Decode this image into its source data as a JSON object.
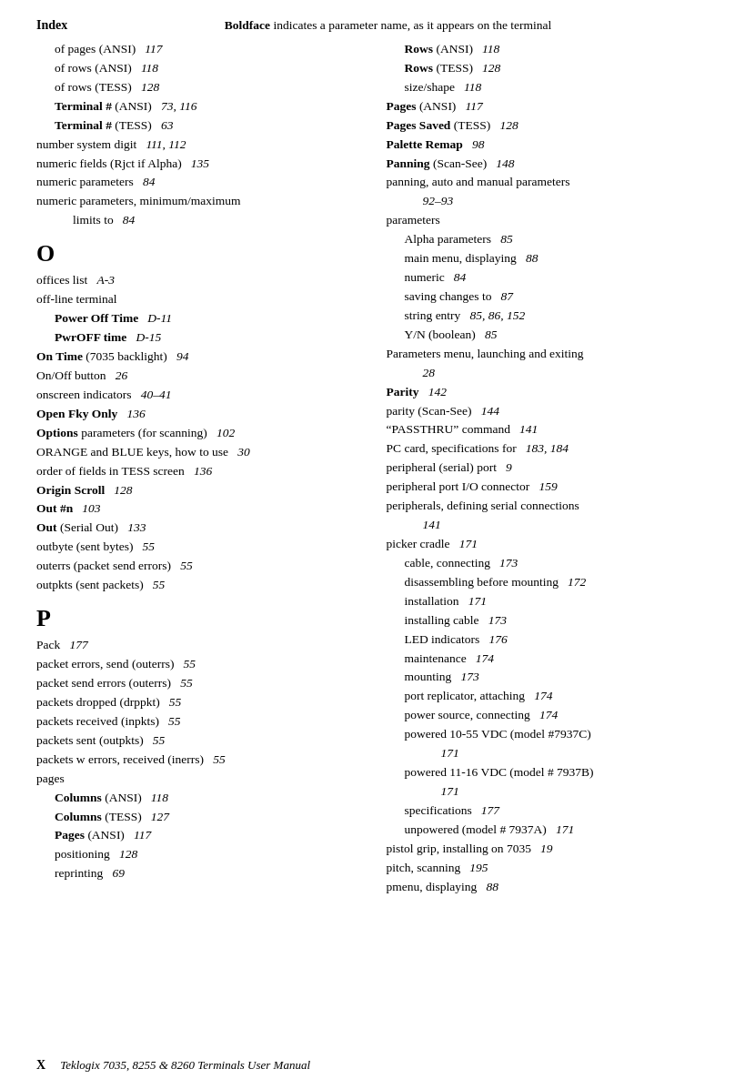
{
  "header": {
    "left_label": "Index",
    "center_bold": "Boldface",
    "center_rest": " indicates a parameter name, as it appears on the terminal"
  },
  "footer": {
    "x_label": "X",
    "title": "Teklogix 7035, 8255 & 8260 Terminals User Manual"
  },
  "left_column": {
    "entries": [
      {
        "text": "of pages (ANSI)",
        "num": "117",
        "indent": 1
      },
      {
        "text": "of rows (ANSI)",
        "num": "118",
        "indent": 1
      },
      {
        "text": "of rows (TESS)",
        "num": "128",
        "indent": 1
      },
      {
        "bold": "Terminal #",
        "after": " (ANSI)",
        "num": "73, 116",
        "indent": 1
      },
      {
        "bold": "Terminal #",
        "after": " (TESS)",
        "num": "63",
        "indent": 1
      },
      {
        "text": "number system digit",
        "num": "111, 112",
        "indent": 0
      },
      {
        "text": "numeric fields (Rjct if Alpha)",
        "num": "135",
        "indent": 0
      },
      {
        "text": "numeric parameters",
        "num": "84",
        "indent": 0
      },
      {
        "text": "numeric parameters, minimum/maximum",
        "indent": 0
      },
      {
        "text": "limits to",
        "num": "84",
        "indent": 2
      }
    ],
    "section_O": {
      "letter": "O",
      "entries": [
        {
          "text": "offices list",
          "num": "A-3",
          "italic_num": true,
          "indent": 0
        },
        {
          "text": "off-line terminal",
          "indent": 0
        },
        {
          "bold": "Power Off Time",
          "num": "D-11",
          "italic_num": true,
          "indent": 1
        },
        {
          "bold": "PwrOFF time",
          "num": "D-15",
          "italic_num": true,
          "indent": 1
        },
        {
          "bold": "On Time",
          "after": " (7035 backlight)",
          "num": "94",
          "indent": 0
        },
        {
          "text": "On/Off button",
          "num": "26",
          "indent": 0
        },
        {
          "text": "onscreen indicators",
          "num": "40–41",
          "indent": 0
        },
        {
          "bold": "Open Fky Only",
          "num": "136",
          "indent": 0
        },
        {
          "bold": "Options",
          "after": " parameters (for scanning)",
          "num": "102",
          "indent": 0
        },
        {
          "text": "ORANGE and BLUE keys, how to use",
          "num": "30",
          "indent": 0
        },
        {
          "text": "order of fields in TESS screen",
          "num": "136",
          "indent": 0
        },
        {
          "bold": "Origin Scroll",
          "num": "128",
          "indent": 0
        },
        {
          "bold": "Out #n",
          "num": "103",
          "indent": 0
        },
        {
          "bold": "Out",
          "after": " (Serial Out)",
          "num": "133",
          "indent": 0
        },
        {
          "text": "outbyte (sent bytes)",
          "num": "55",
          "indent": 0
        },
        {
          "text": "outerrs (packet send errors)",
          "num": "55",
          "indent": 0
        },
        {
          "text": "outpkts (sent packets)",
          "num": "55",
          "indent": 0
        }
      ]
    },
    "section_P": {
      "letter": "P",
      "entries": [
        {
          "text": "Pack",
          "num": "177",
          "indent": 0
        },
        {
          "text": "packet errors, send (outerrs)",
          "num": "55",
          "indent": 0
        },
        {
          "text": "packet send errors (outerrs)",
          "num": "55",
          "indent": 0
        },
        {
          "text": "packets dropped (drppkt)",
          "num": "55",
          "indent": 0
        },
        {
          "text": "packets received (inpkts)",
          "num": "55",
          "indent": 0
        },
        {
          "text": "packets sent (outpkts)",
          "num": "55",
          "indent": 0
        },
        {
          "text": "packets w errors, received (inerrs)",
          "num": "55",
          "indent": 0
        },
        {
          "text": "pages",
          "indent": 0
        },
        {
          "bold": "Columns",
          "after": " (ANSI)",
          "num": "118",
          "indent": 1
        },
        {
          "bold": "Columns",
          "after": " (TESS)",
          "num": "127",
          "indent": 1
        },
        {
          "bold": "Pages",
          "after": " (ANSI)",
          "num": "117",
          "indent": 1
        },
        {
          "text": "positioning",
          "num": "128",
          "indent": 1
        },
        {
          "text": "reprinting",
          "num": "69",
          "indent": 1
        }
      ]
    }
  },
  "right_column": {
    "entries": [
      {
        "bold": "Rows",
        "after": " (ANSI)",
        "num": "118",
        "indent": 1
      },
      {
        "bold": "Rows",
        "after": " (TESS)",
        "num": "128",
        "indent": 1
      },
      {
        "text": "size/shape",
        "num": "118",
        "indent": 1
      },
      {
        "bold": "Pages",
        "after": " (ANSI)",
        "num": "117",
        "indent": 0
      },
      {
        "bold": "Pages Saved",
        "after": " (TESS)",
        "num": "128",
        "indent": 0
      },
      {
        "bold": "Palette Remap",
        "num": "98",
        "indent": 0
      },
      {
        "bold": "Panning",
        "after": " (Scan-See)",
        "num": "148",
        "italic_num": true,
        "indent": 0
      },
      {
        "text": "panning, auto and manual parameters",
        "indent": 0
      },
      {
        "text": "92–93",
        "indent": 2,
        "italic_num": true
      },
      {
        "text": "parameters",
        "indent": 0
      },
      {
        "text": "Alpha parameters",
        "num": "85",
        "indent": 1
      },
      {
        "text": "main menu, displaying",
        "num": "88",
        "indent": 1
      },
      {
        "text": "numeric",
        "num": "84",
        "indent": 1
      },
      {
        "text": "saving changes to",
        "num": "87",
        "indent": 1
      },
      {
        "text": "string entry",
        "num": "85, 86, 152",
        "indent": 1
      },
      {
        "text": "Y/N (boolean)",
        "num": "85",
        "indent": 1
      },
      {
        "text": "Parameters menu, launching and exiting",
        "indent": 0
      },
      {
        "text": "28",
        "indent": 2,
        "italic_num": true
      },
      {
        "bold": "Parity",
        "num": "142",
        "indent": 0
      },
      {
        "text": "parity (Scan-See)",
        "num": "144",
        "indent": 0
      },
      {
        "text": "“PASSTHRU” command",
        "num": "141",
        "italic_num": true,
        "indent": 0
      },
      {
        "text": "PC card, specifications for",
        "num": "183, 184",
        "indent": 0
      },
      {
        "text": "peripheral (serial) port",
        "num": "9",
        "indent": 0
      },
      {
        "text": "peripheral port I/O connector",
        "num": "159",
        "indent": 0
      },
      {
        "text": "peripherals, defining serial connections",
        "indent": 0
      },
      {
        "text": "141",
        "indent": 2,
        "italic_num": true
      },
      {
        "text": "picker cradle",
        "num": "171",
        "indent": 0
      },
      {
        "text": "cable, connecting",
        "num": "173",
        "indent": 1
      },
      {
        "text": "disassembling before mounting",
        "num": "172",
        "indent": 1
      },
      {
        "text": "installation",
        "num": "171",
        "indent": 1
      },
      {
        "text": "installing cable",
        "num": "173",
        "indent": 1
      },
      {
        "text": "LED indicators",
        "num": "176",
        "indent": 1
      },
      {
        "text": "maintenance",
        "num": "174",
        "indent": 1
      },
      {
        "text": "mounting",
        "num": "173",
        "indent": 1
      },
      {
        "text": "port replicator, attaching",
        "num": "174",
        "indent": 1
      },
      {
        "text": "power source, connecting",
        "num": "174",
        "indent": 1
      },
      {
        "text": "powered 10-55 VDC (model #7937C)",
        "indent": 1
      },
      {
        "text": "171",
        "indent": 3,
        "italic_num": true
      },
      {
        "text": "powered 11-16 VDC (model # 7937B)",
        "indent": 1
      },
      {
        "text": "171",
        "indent": 3,
        "italic_num": true
      },
      {
        "text": "specifications",
        "num": "177",
        "indent": 1
      },
      {
        "text": "unpowered (model # 7937A)",
        "num": "171",
        "indent": 1
      },
      {
        "text": "pistol grip, installing on 7035",
        "num": "19",
        "indent": 0
      },
      {
        "text": "pitch, scanning",
        "num": "195",
        "indent": 0
      },
      {
        "text": "pmenu, displaying",
        "num": "88",
        "indent": 0
      }
    ]
  }
}
